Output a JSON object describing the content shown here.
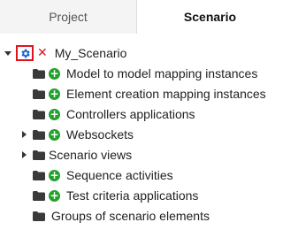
{
  "tabs": [
    {
      "label": "Project",
      "active": false
    },
    {
      "label": "Scenario",
      "active": true
    }
  ],
  "tree": {
    "root": {
      "label": "My_Scenario",
      "expanded": true,
      "icon": "gear-icon",
      "remove_icon": "close-icon"
    },
    "items": [
      {
        "label": "Model to model mapping instances",
        "expandable": false,
        "add": true
      },
      {
        "label": "Element creation mapping instances",
        "expandable": false,
        "add": true
      },
      {
        "label": "Controllers applications",
        "expandable": false,
        "add": true
      },
      {
        "label": "Websockets",
        "expandable": true,
        "add": true
      },
      {
        "label": "Scenario views",
        "expandable": true,
        "add": false
      },
      {
        "label": "Sequence activities",
        "expandable": false,
        "add": true
      },
      {
        "label": "Test criteria applications",
        "expandable": false,
        "add": true
      },
      {
        "label": "Groups of scenario elements",
        "expandable": false,
        "add": false
      }
    ]
  },
  "colors": {
    "add": "#22a22c",
    "remove": "#e0141e",
    "gear": "#1e5fcf",
    "folder": "#3a3a3a"
  }
}
